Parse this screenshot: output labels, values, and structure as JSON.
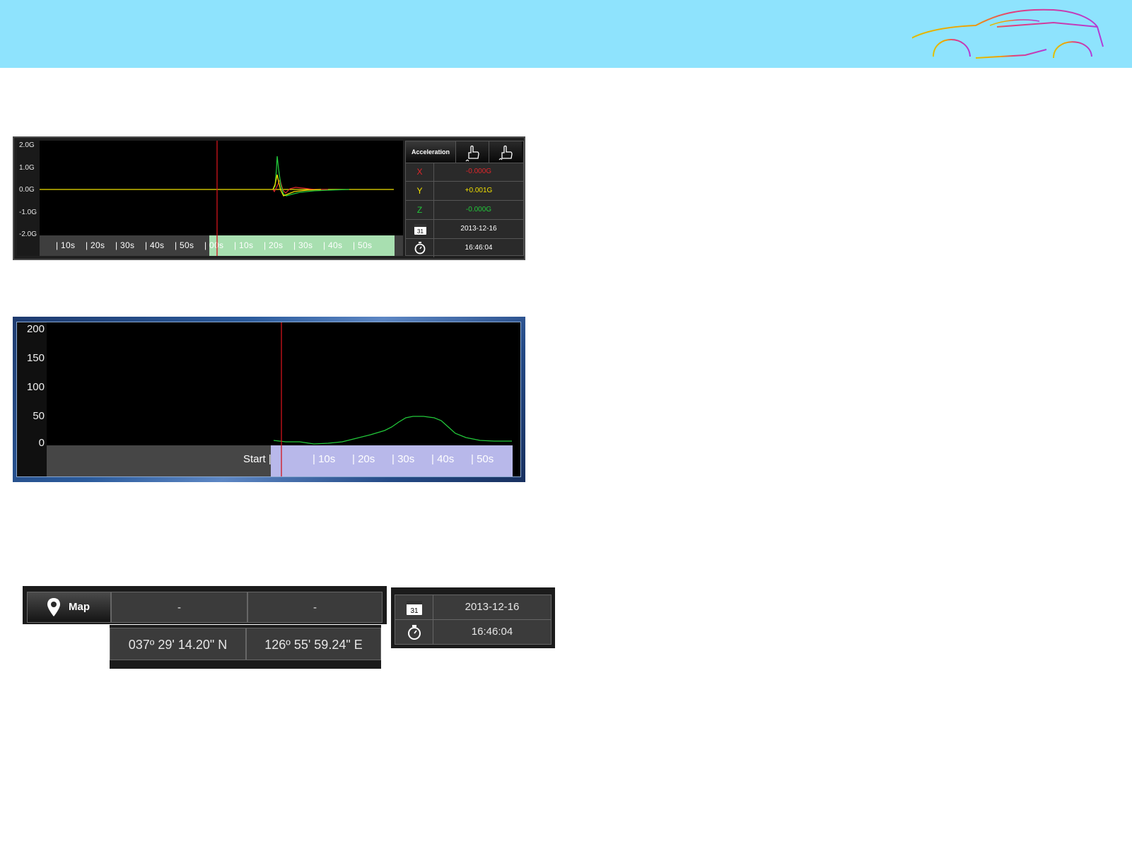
{
  "colors": {
    "topbar": "#8ee3fd",
    "x_axis_color": "#e0262a",
    "y_axis_color": "#f0e000",
    "z_axis_color": "#22c83a",
    "cursor": "#d0141c",
    "speed_line": "#22c83a"
  },
  "accel": {
    "y_ticks": [
      "2.0G",
      "1.0G",
      "0.0G",
      "-1.0G",
      "-2.0G"
    ],
    "time_ticks_first": [
      "| 10s",
      "| 20s",
      "| 30s",
      "| 40s",
      "| 50s"
    ],
    "time_ticks_second": [
      "| 00s",
      "| 10s",
      "| 20s",
      "| 30s",
      "| 40s",
      "| 50s"
    ],
    "table": {
      "header_label": "Acceleration",
      "header_icons": [
        "hand-pointer-up-icon",
        "hand-pointer-down-icon"
      ],
      "x_label": "X",
      "x_value": "-0.000G",
      "y_label": "Y",
      "y_value": "+0.001G",
      "z_label": "Z",
      "z_value": "-0.000G",
      "date_icon": "calendar-icon",
      "date": "2013-12-16",
      "time_icon": "stopwatch-icon",
      "time": "16:46:04"
    }
  },
  "speed": {
    "y_ticks": [
      "200",
      "150",
      "100",
      "50",
      "0"
    ],
    "start_label": "Start |",
    "time_ticks": [
      "| 10s",
      "| 20s",
      "| 30s",
      "| 40s",
      "| 50s"
    ]
  },
  "map": {
    "button_label": "Map",
    "button_icon": "map-pin-icon",
    "lat_placeholder": "-",
    "lon_placeholder": "-",
    "latitude": "037º 29' 14.20\" N",
    "longitude": "126º 55' 59.24\" E",
    "date_icon": "calendar-icon",
    "date": "2013-12-16",
    "time_icon": "stopwatch-icon",
    "time": "16:46:04"
  }
}
